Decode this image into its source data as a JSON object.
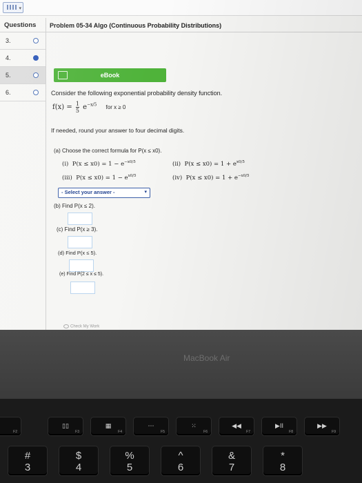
{
  "topbar": {
    "menu_icon": "grid-menu-icon"
  },
  "header": {
    "questions_label": "Questions",
    "problem_title": "Problem 05-34 Algo (Continuous Probability Distributions)"
  },
  "questions": [
    {
      "number": "3.",
      "status": "open"
    },
    {
      "number": "4.",
      "status": "filled"
    },
    {
      "number": "5.",
      "status": "open"
    },
    {
      "number": "6.",
      "status": "open"
    }
  ],
  "ebook": {
    "label": "eBook",
    "icon": "book-icon"
  },
  "problem": {
    "intro": "Consider the following exponential probability density function.",
    "formula_lhs": "f(x) =",
    "frac_num": "1",
    "frac_den": "5",
    "exp_base": "e",
    "exp_power": "−x/5",
    "domain": "for x ≥ 0",
    "round_note": "If needed, round your answer to four decimal digits."
  },
  "part_a": {
    "prompt": "(a) Choose the correct formula for P(x ≤ x0).",
    "options": [
      {
        "label": "(i)",
        "expr": "P(x ≤ x0) = 1 − e",
        "power": "−x0/5"
      },
      {
        "label": "(ii)",
        "expr": "P(x ≤ x0) = 1 + e",
        "power": "x0/5"
      },
      {
        "label": "(iii)",
        "expr": "P(x ≤ x0) = 1 − e",
        "power": "x0/5"
      },
      {
        "label": "(iv)",
        "expr": "P(x ≤ x0) = 1 + e",
        "power": "−x0/5"
      }
    ],
    "select_text": "- Select your answer -",
    "select_chevron": "chevron-down-icon"
  },
  "part_b": {
    "prompt": "(b) Find P(x ≤ 2).",
    "value": ""
  },
  "part_c": {
    "prompt": "(c) Find P(x ≥ 3).",
    "value": ""
  },
  "part_d": {
    "prompt": "(d) Find P(x ≤ 5).",
    "value": ""
  },
  "part_e": {
    "prompt": "(e) Find P(2 ≤ x ≤ 5).",
    "value": ""
  },
  "hint": "Check My Work",
  "device": {
    "brand": "MacBook Air",
    "fkeys": [
      {
        "glyph": "",
        "fn": "F2"
      },
      {
        "glyph": "▯▯",
        "fn": "F3"
      },
      {
        "glyph": "▦",
        "fn": "F4"
      },
      {
        "glyph": "⋯",
        "fn": "F5"
      },
      {
        "glyph": "⁙",
        "fn": "F6"
      },
      {
        "glyph": "◀◀",
        "fn": "F7"
      },
      {
        "glyph": "▶II",
        "fn": "F8"
      },
      {
        "glyph": "▶▶",
        "fn": "F9"
      }
    ],
    "numkeys": [
      {
        "sym": "#",
        "digit": "3"
      },
      {
        "sym": "$",
        "digit": "4"
      },
      {
        "sym": "%",
        "digit": "5"
      },
      {
        "sym": "^",
        "digit": "6"
      },
      {
        "sym": "&",
        "digit": "7"
      },
      {
        "sym": "*",
        "digit": "8"
      }
    ]
  }
}
